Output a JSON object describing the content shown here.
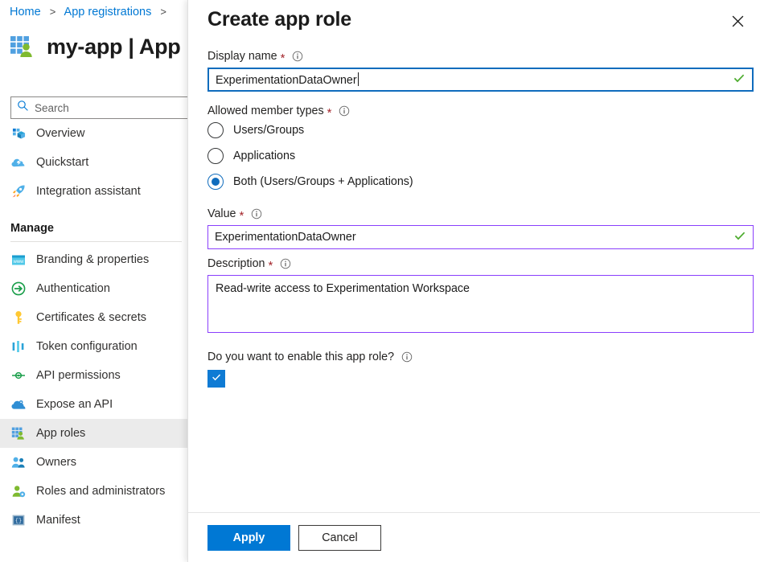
{
  "portal": {
    "breadcrumb": {
      "items": [
        "Home",
        "App registrations"
      ],
      "separator": ">",
      "trailing_separator": ">"
    },
    "page_title": "my-app | App",
    "search": {
      "placeholder": "Search",
      "value": "",
      "icon": "search-icon"
    },
    "nav": [
      {
        "label": "Overview",
        "icon": "overview-icon",
        "selected": false,
        "group": null
      },
      {
        "label": "Quickstart",
        "icon": "quickstart-cloud-icon",
        "selected": false,
        "group": null
      },
      {
        "label": "Integration assistant",
        "icon": "rocket-icon",
        "selected": false,
        "group": null
      }
    ],
    "group_heading": "Manage",
    "nav_manage": [
      {
        "label": "Branding & properties",
        "icon": "branding-icon",
        "selected": false
      },
      {
        "label": "Authentication",
        "icon": "authentication-arrow-icon",
        "selected": false
      },
      {
        "label": "Certificates & secrets",
        "icon": "key-icon",
        "selected": false
      },
      {
        "label": "Token configuration",
        "icon": "token-bars-icon",
        "selected": false
      },
      {
        "label": "API permissions",
        "icon": "api-permissions-icon",
        "selected": false
      },
      {
        "label": "Expose an API",
        "icon": "expose-api-cloud-icon",
        "selected": false
      },
      {
        "label": "App roles",
        "icon": "app-roles-grid-person-icon",
        "selected": true
      },
      {
        "label": "Owners",
        "icon": "owners-people-icon",
        "selected": false
      },
      {
        "label": "Roles and administrators",
        "icon": "roles-admin-person-icon",
        "selected": false
      },
      {
        "label": "Manifest",
        "icon": "manifest-braces-icon",
        "selected": false
      }
    ]
  },
  "blade": {
    "title": "Create app role",
    "close_icon": "close-icon",
    "fields": {
      "display_name": {
        "label": "Display name",
        "required_marker": "*",
        "info_icon": "info-icon",
        "value": "ExperimentationDataOwner",
        "placeholder": "",
        "validation_icon": "green-check-icon",
        "state": "focused"
      },
      "allowed_member_types": {
        "label": "Allowed member types",
        "required_marker": "*",
        "info_icon": "info-icon",
        "options": [
          {
            "label": "Users/Groups",
            "selected": false
          },
          {
            "label": "Applications",
            "selected": false
          },
          {
            "label": "Both (Users/Groups + Applications)",
            "selected": true
          }
        ]
      },
      "value": {
        "label": "Value",
        "required_marker": "*",
        "info_icon": "info-icon",
        "value": "ExperimentationDataOwner",
        "placeholder": "",
        "validation_icon": "green-check-icon",
        "state": "valid"
      },
      "description": {
        "label": "Description",
        "required_marker": "*",
        "info_icon": "info-icon",
        "value": "Read-write access to Experimentation Workspace",
        "placeholder": ""
      },
      "enable": {
        "label": "Do you want to enable this app role?",
        "info_icon": "info-icon",
        "checked": true,
        "check_icon": "checkmark-icon"
      }
    },
    "footer": {
      "apply_label": "Apply",
      "cancel_label": "Cancel"
    }
  },
  "colors": {
    "accent_blue": "#0078d4",
    "link_blue": "#0078d4",
    "focus_blue": "#0f6cbd",
    "valid_purple": "#8a3ffc",
    "success_green": "#4cab2d",
    "required_red": "#a4262c",
    "selected_row_gray": "#ebebeb"
  }
}
